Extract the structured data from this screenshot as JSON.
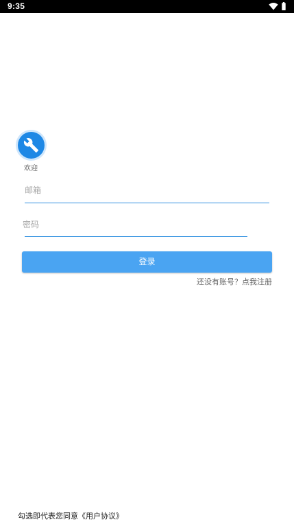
{
  "status_bar": {
    "time": "9:35",
    "icons": [
      "wifi-icon",
      "battery-icon"
    ]
  },
  "header": {
    "logo_icon": "wrench-icon",
    "welcome": "欢迎"
  },
  "form": {
    "email_placeholder": "邮箱",
    "password_placeholder": "密码",
    "login_label": "登录",
    "register_link": "还没有账号？点我注册"
  },
  "footer": {
    "agreement": "勾选即代表您同意《用户协议》"
  },
  "colors": {
    "accent": "#1e88e5",
    "button": "#4aa4f2",
    "underline": "#2f8fe0"
  }
}
